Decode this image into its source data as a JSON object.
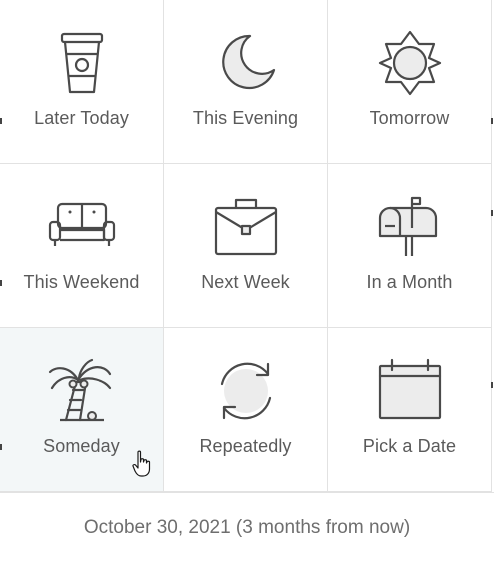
{
  "options": [
    {
      "label": "Later Today",
      "icon": "coffee-cup-icon"
    },
    {
      "label": "This Evening",
      "icon": "moon-icon"
    },
    {
      "label": "Tomorrow",
      "icon": "sun-icon"
    },
    {
      "label": "This Weekend",
      "icon": "couch-icon"
    },
    {
      "label": "Next Week",
      "icon": "briefcase-icon"
    },
    {
      "label": "In a Month",
      "icon": "mailbox-icon"
    },
    {
      "label": "Someday",
      "icon": "palm-tree-icon"
    },
    {
      "label": "Repeatedly",
      "icon": "repeat-icon"
    },
    {
      "label": "Pick a Date",
      "icon": "calendar-icon"
    }
  ],
  "footer": {
    "text": "October 30, 2021 (3 months from now)"
  },
  "colors": {
    "icon_stroke": "#4a4a4a",
    "icon_fill": "#ececec",
    "hover_bg": "#f3f7f8",
    "label": "#5a5a5a"
  }
}
